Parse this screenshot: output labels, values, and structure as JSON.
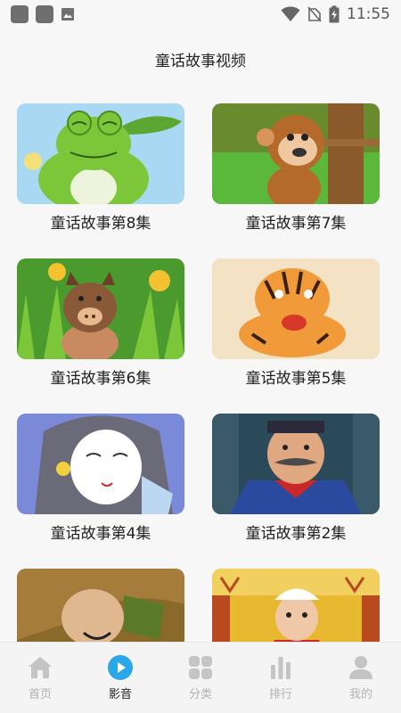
{
  "status_bar": {
    "time": "11:55",
    "left_icons": [
      "app-icon",
      "app-icon",
      "image-icon"
    ],
    "right_icons": [
      "wifi-icon",
      "no-sim-icon",
      "battery-charging-icon"
    ]
  },
  "page": {
    "title": "童话故事视频"
  },
  "videos": [
    {
      "title": "童话故事第8集",
      "thumb": "frog-cartoon"
    },
    {
      "title": "童话故事第7集",
      "thumb": "monkey-cartoon"
    },
    {
      "title": "童话故事第6集",
      "thumb": "boar-cartoon"
    },
    {
      "title": "童话故事第5集",
      "thumb": "tiger-cartoon"
    },
    {
      "title": "童话故事第4集",
      "thumb": "girl-cartoon"
    },
    {
      "title": "童话故事第2集",
      "thumb": "mustache-man-cartoon"
    },
    {
      "title": "",
      "thumb": "old-man-cartoon"
    },
    {
      "title": "",
      "thumb": "boy-cartoon"
    }
  ],
  "nav": {
    "active_index": 1,
    "items": [
      {
        "label": "首页",
        "icon": "home-icon"
      },
      {
        "label": "影音",
        "icon": "play-icon"
      },
      {
        "label": "分类",
        "icon": "grid-icon"
      },
      {
        "label": "排行",
        "icon": "bar-chart-icon"
      },
      {
        "label": "我的",
        "icon": "user-icon"
      }
    ]
  },
  "colors": {
    "accent": "#2aa7e8",
    "inactive": "#b2b2b2",
    "text": "#222222"
  }
}
